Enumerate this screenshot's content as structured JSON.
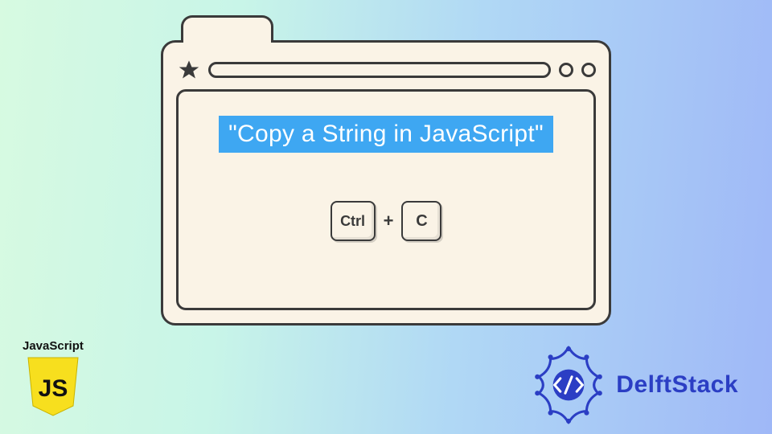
{
  "highlight_text": "\"Copy a String in JavaScript\"",
  "keys": {
    "ctrl": "Ctrl",
    "plus": "+",
    "c": "C"
  },
  "js_badge": {
    "label": "JavaScript",
    "shield_text": "JS"
  },
  "brand": {
    "name": "DelftStack"
  },
  "colors": {
    "highlight_bg": "#3ea7f2",
    "brand_blue": "#2b3ec4",
    "window_bg": "#faf3e6",
    "stroke": "#3a3a3a",
    "js_yellow": "#f7df1e"
  }
}
